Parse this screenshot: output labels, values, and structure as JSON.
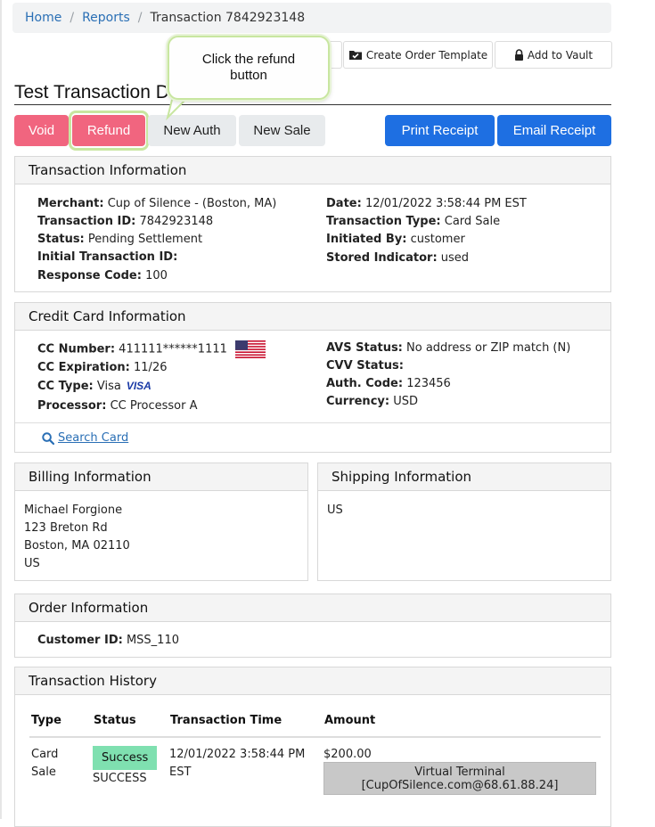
{
  "breadcrumb": {
    "home": "Home",
    "reports": "Reports",
    "current": "Transaction 7842923148"
  },
  "toolbar": {
    "create_order_template": "Create Order Template",
    "add_to_vault": "Add to Vault"
  },
  "callout": {
    "text": "Click the refund button"
  },
  "page_title": "Test Transaction D",
  "actions": {
    "void": "Void",
    "refund": "Refund",
    "new_auth": "New Auth",
    "new_sale": "New Sale",
    "print_receipt": "Print Receipt",
    "email_receipt": "Email Receipt"
  },
  "transaction_info": {
    "title": "Transaction Information",
    "merchant_label": "Merchant:",
    "merchant": "Cup of Silence - (Boston, MA)",
    "txid_label": "Transaction ID:",
    "txid": "7842923148",
    "status_label": "Status:",
    "status": "Pending Settlement",
    "initial_label": "Initial Transaction ID:",
    "initial": "",
    "response_label": "Response Code:",
    "response": "100",
    "date_label": "Date:",
    "date": "12/01/2022 3:58:44 PM EST",
    "type_label": "Transaction Type:",
    "type": "Card Sale",
    "initiated_label": "Initiated By:",
    "initiated": "customer",
    "stored_label": "Stored Indicator:",
    "stored": "used"
  },
  "credit_card": {
    "title": "Credit Card Information",
    "number_label": "CC Number:",
    "number": "411111******1111",
    "exp_label": "CC Expiration:",
    "exp": "11/26",
    "type_label": "CC Type:",
    "type": "Visa",
    "brand_mark": "VISA",
    "processor_label": "Processor:",
    "processor": "CC Processor A",
    "avs_label": "AVS Status:",
    "avs": "No address or ZIP match (N)",
    "cvv_label": "CVV Status:",
    "cvv": "",
    "auth_label": "Auth. Code:",
    "auth": "123456",
    "currency_label": "Currency:",
    "currency": "USD",
    "search_card": "Search Card"
  },
  "billing": {
    "title": "Billing Information",
    "name": "Michael Forgione",
    "street": "123 Breton Rd",
    "city": "Boston, MA 02110",
    "country": "US"
  },
  "shipping": {
    "title": "Shipping Information",
    "country": "US"
  },
  "order": {
    "title": "Order Information",
    "customer_label": "Customer ID:",
    "customer": "MSS_110"
  },
  "history": {
    "title": "Transaction History",
    "columns": [
      "Type",
      "Status",
      "Transaction Time",
      "Amount"
    ],
    "rows": [
      {
        "type_line1": "Card",
        "type_line2": "Sale",
        "status_badge": "Success",
        "status_text": "SUCCESS",
        "time_line1": "12/01/2022 3:58:44 PM",
        "time_line2": "EST",
        "amount": "$200.00",
        "source_line1": "Virtual Terminal",
        "source_line2": "[CupOfSilence.com@68.61.88.24]"
      }
    ]
  },
  "colors": {
    "pink": "#f1657f",
    "blue": "#1e6fe2",
    "link": "#2a6fb5",
    "success": "#7fe0b0"
  }
}
